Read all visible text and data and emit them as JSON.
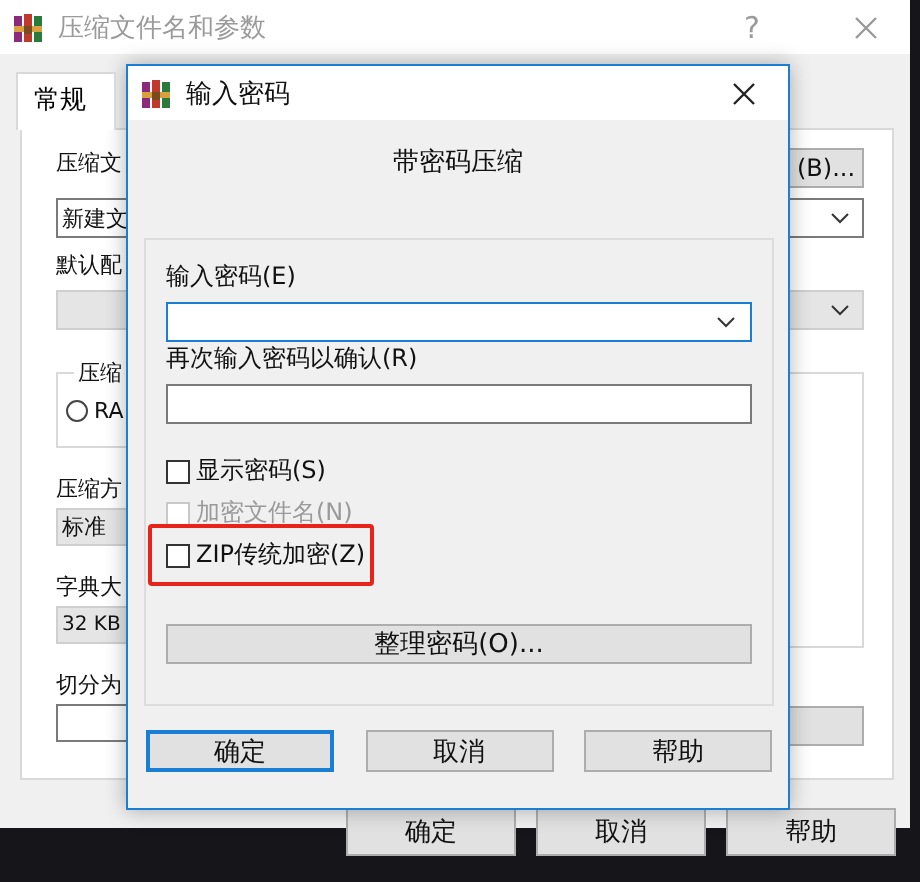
{
  "main_window": {
    "title": "压缩文件名和参数",
    "help_button": "?",
    "tabs": [
      {
        "label": "常规",
        "selected": true
      }
    ],
    "archive_name_label": "压缩文",
    "browse_button": "(B)...",
    "archive_name_value": "新建文",
    "profile_label": "默认配",
    "format_group_label": "压缩",
    "format_radio": {
      "label": "RA",
      "selected": false
    },
    "method_label": "压缩方",
    "method_value": "标准",
    "dictionary_label": "字典大",
    "dictionary_value": "32 KB",
    "split_label": "切分为",
    "buttons": [
      "确定",
      "取消",
      "帮助"
    ]
  },
  "dialog": {
    "title": "输入密码",
    "heading": "带密码压缩",
    "password_label": "输入密码(E)",
    "confirm_label": "再次输入密码以确认(R)",
    "checkboxes": [
      {
        "label": "显示密码(S)",
        "checked": false,
        "disabled": false,
        "highlighted": false
      },
      {
        "label": "加密文件名(N)",
        "checked": false,
        "disabled": true,
        "highlighted": false
      },
      {
        "label": "ZIP传统加密(Z)",
        "checked": false,
        "disabled": false,
        "highlighted": true
      }
    ],
    "organize_button": "整理密码(O)...",
    "buttons": [
      {
        "label": "确定",
        "default": true
      },
      {
        "label": "取消",
        "default": false
      },
      {
        "label": "帮助",
        "default": false
      }
    ]
  }
}
